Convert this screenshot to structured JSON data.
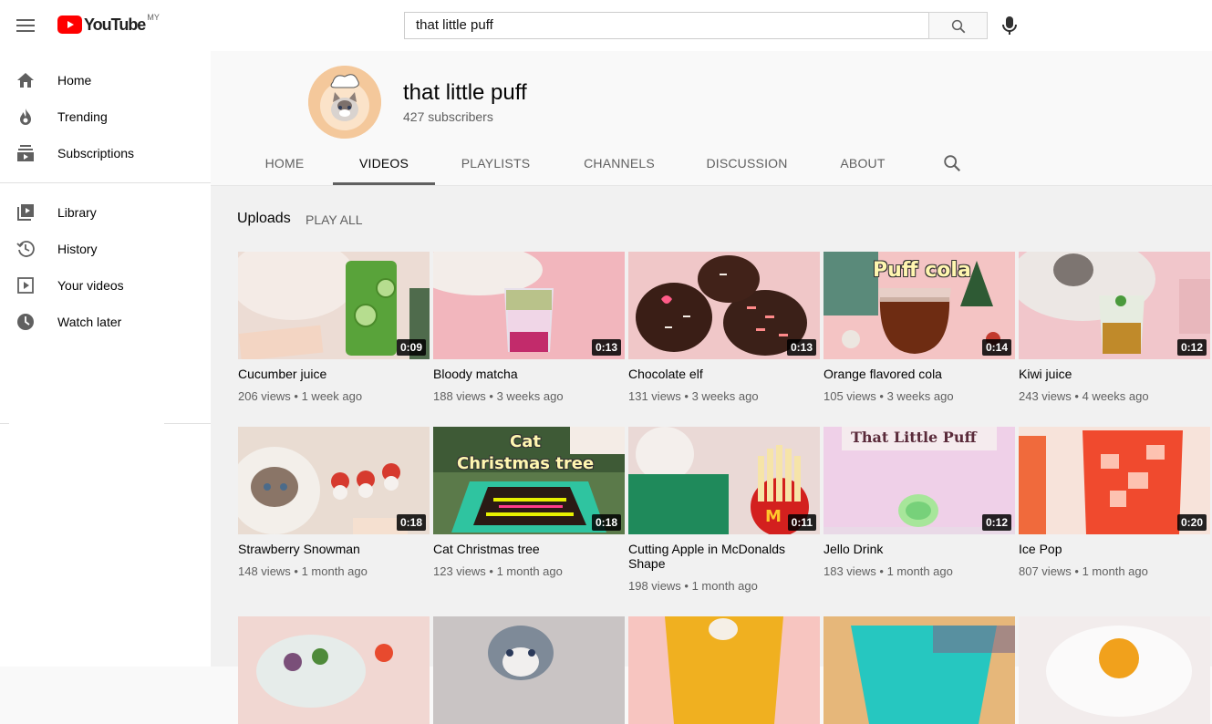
{
  "masthead": {
    "logo_text": "YouTube",
    "region": "MY",
    "search_value": "that little puff"
  },
  "sidebar": {
    "items": [
      {
        "label": "Home",
        "icon": "home-icon"
      },
      {
        "label": "Trending",
        "icon": "trending-icon"
      },
      {
        "label": "Subscriptions",
        "icon": "subscriptions-icon"
      },
      {
        "label": "Library",
        "icon": "library-icon"
      },
      {
        "label": "History",
        "icon": "history-icon"
      },
      {
        "label": "Your videos",
        "icon": "your-videos-icon"
      },
      {
        "label": "Watch later",
        "icon": "watch-later-icon"
      }
    ]
  },
  "channel": {
    "name": "that little puff",
    "subscribers": "427 subscribers",
    "tabs": [
      "HOME",
      "VIDEOS",
      "PLAYLISTS",
      "CHANNELS",
      "DISCUSSION",
      "ABOUT"
    ],
    "active_tab": "VIDEOS"
  },
  "uploads": {
    "title": "Uploads",
    "play_all": "PLAY ALL"
  },
  "thumb_text": {
    "puff_cola": "Puff cola",
    "cat_xmas": "Cat",
    "cat_xmas2": "Christmas tree",
    "that_little_puff": "That Little Puff"
  },
  "videos": [
    {
      "title": "Cucumber juice",
      "views": "206 views",
      "age": "1 week ago",
      "duration": "0:09",
      "colors": [
        "#e9dcd6",
        "#4c8f2b"
      ]
    },
    {
      "title": "Bloody matcha",
      "views": "188 views",
      "age": "3 weeks ago",
      "duration": "0:13",
      "colors": [
        "#f2b9bd",
        "#c8d8a8"
      ]
    },
    {
      "title": "Chocolate elf",
      "views": "131 views",
      "age": "3 weeks ago",
      "duration": "0:13",
      "colors": [
        "#f0c7c8",
        "#3b1f18"
      ]
    },
    {
      "title": "Orange flavored cola",
      "views": "105 views",
      "age": "3 weeks ago",
      "duration": "0:14",
      "colors": [
        "#f4c2c2",
        "#6b3a1a"
      ]
    },
    {
      "title": "Kiwi juice",
      "views": "243 views",
      "age": "4 weeks ago",
      "duration": "0:12",
      "colors": [
        "#f1c4c9",
        "#8fb04e"
      ]
    },
    {
      "title": "Strawberry Snowman",
      "views": "148 views",
      "age": "1 month ago",
      "duration": "0:18",
      "colors": [
        "#ead4c8",
        "#d63a2e"
      ]
    },
    {
      "title": "Cat Christmas tree",
      "views": "123 views",
      "age": "1 month ago",
      "duration": "0:18",
      "colors": [
        "#4a6d3f",
        "#2ec8a0"
      ]
    },
    {
      "title": "Cutting Apple in McDonalds Shape",
      "views": "198 views",
      "age": "1 month ago",
      "duration": "0:11",
      "colors": [
        "#e8d6d2",
        "#1f8a5b"
      ]
    },
    {
      "title": "Jello Drink",
      "views": "183 views",
      "age": "1 month ago",
      "duration": "0:12",
      "colors": [
        "#eecfe6",
        "#9be39a"
      ]
    },
    {
      "title": "Ice Pop",
      "views": "807 views",
      "age": "1 month ago",
      "duration": "0:20",
      "colors": [
        "#f8e6dc",
        "#f04a2e"
      ]
    }
  ],
  "row3_colors": [
    [
      "#f1d7d2",
      "#7a4f79"
    ],
    [
      "#c9c4c4",
      "#7e8a98"
    ],
    [
      "#f7c5c0",
      "#f0b020"
    ],
    [
      "#e6b77a",
      "#26c7c0"
    ],
    [
      "#f2ecec",
      "#f1a11c"
    ]
  ]
}
